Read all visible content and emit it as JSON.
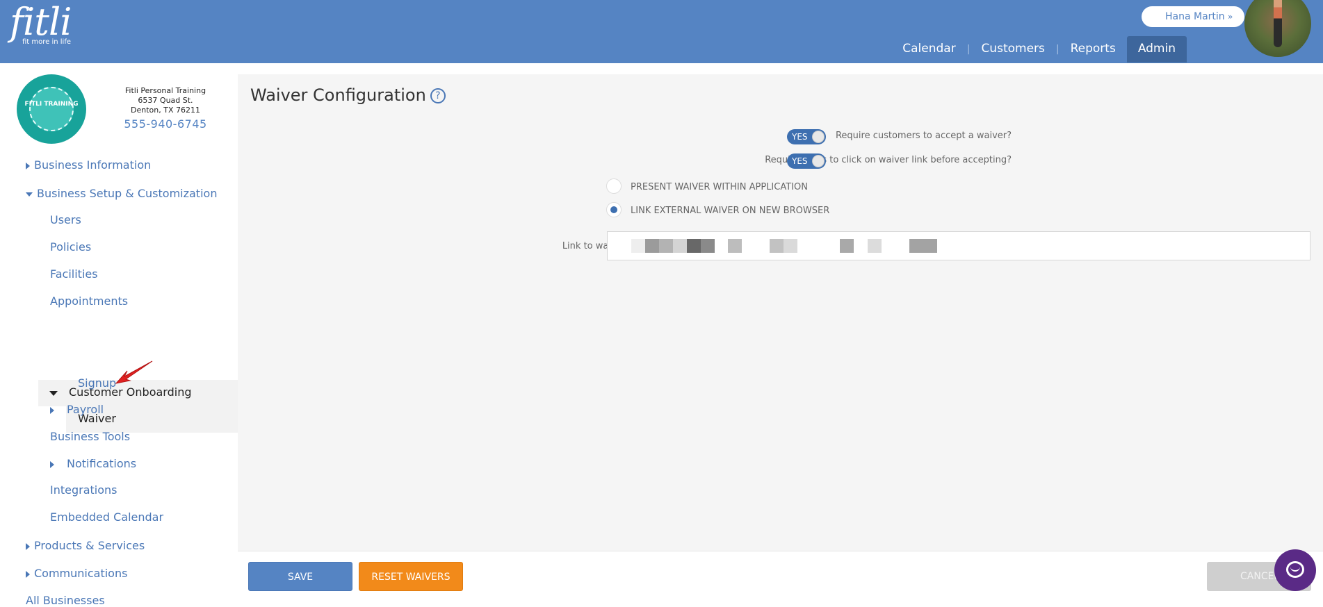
{
  "header": {
    "logo": {
      "word": "fitli",
      "tagline": "fit more in life"
    },
    "user": {
      "name": "Hana Martin",
      "chevron": "»"
    },
    "nav": [
      {
        "label": "Calendar"
      },
      {
        "label": "Customers"
      },
      {
        "label": "Reports"
      },
      {
        "label": "Admin",
        "active": true
      }
    ]
  },
  "business": {
    "logo_text": "FITLI TRAINING",
    "name": "Fitli Personal Training",
    "address1": "6537 Quad St.",
    "address2": "Denton, TX 76211",
    "phone": "555-940-6745"
  },
  "sidebar": {
    "business_information": "Business Information",
    "business_setup": "Business Setup & Customization",
    "users": "Users",
    "policies": "Policies",
    "facilities": "Facilities",
    "appointments": "Appointments",
    "customer_onboarding": "Customer Onboarding",
    "waiver": "Waiver",
    "signup": "Signup",
    "payroll": "Payroll",
    "business_tools": "Business Tools",
    "notifications": "Notifications",
    "integrations": "Integrations",
    "embedded_calendar": "Embedded Calendar",
    "products_services": "Products & Services",
    "communications": "Communications",
    "all_businesses": "All Businesses"
  },
  "main": {
    "title": "Waiver Configuration",
    "help_icon": "?",
    "require_accept": {
      "label": "Require customers to accept a waiver?",
      "value": "YES"
    },
    "require_click": {
      "label": "Require users to click on waiver link before accepting?",
      "value": "YES"
    },
    "present_option": {
      "label": "PRESENT WAIVER WITHIN APPLICATION",
      "checked": false
    },
    "link_option": {
      "label": "LINK EXTERNAL WAIVER ON NEW BROWSER",
      "checked": true
    },
    "link_label": "Link to waiver"
  },
  "footer": {
    "save": "SAVE",
    "reset": "RESET WAIVERS",
    "cancel": "CANCEL"
  },
  "colors": {
    "header_bg": "#5584c3",
    "nav_active": "#3d669c",
    "accent_orange": "#f28a1a",
    "chat_purple": "#5a2a86"
  }
}
